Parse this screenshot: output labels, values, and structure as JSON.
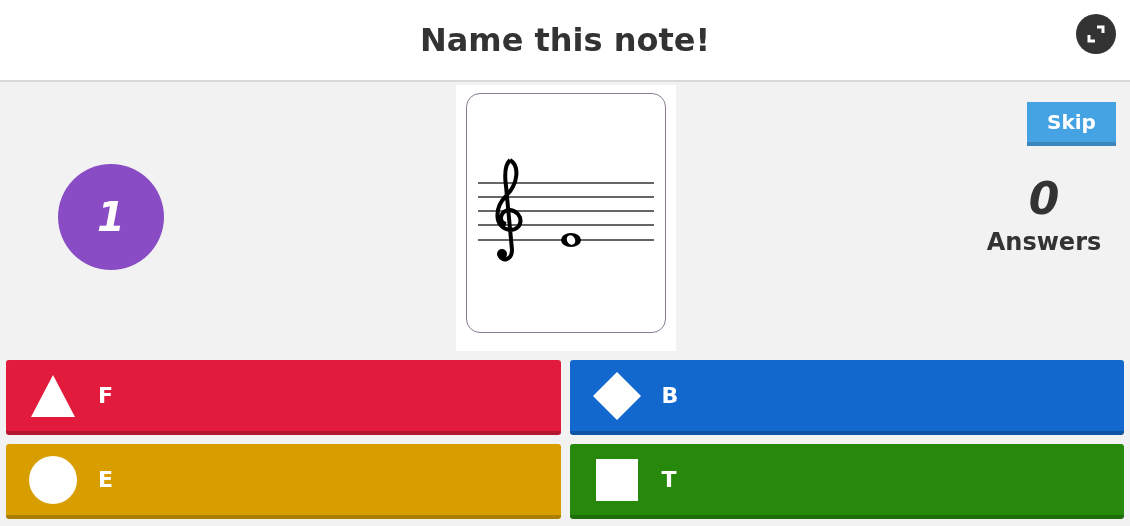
{
  "header": {
    "title": "Name this note!"
  },
  "timer": {
    "value": "1"
  },
  "skip_button": {
    "label": "Skip"
  },
  "answers_count": {
    "value": "0",
    "label": "Answers"
  },
  "answers": [
    {
      "kind": "triangle",
      "label": "F",
      "color": "#e21b3c"
    },
    {
      "kind": "diamond",
      "label": "B",
      "color": "#1368ce"
    },
    {
      "kind": "circle",
      "label": "E",
      "color": "#d89e00"
    },
    {
      "kind": "square",
      "label": "T",
      "color": "#26890c"
    }
  ]
}
